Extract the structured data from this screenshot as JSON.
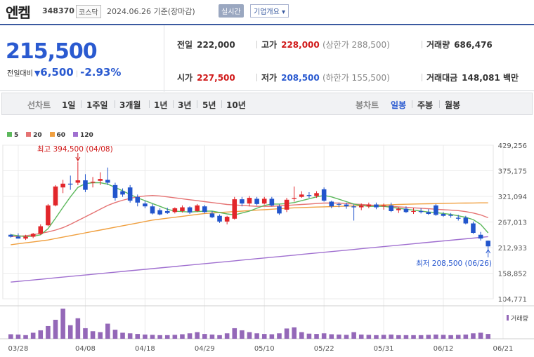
{
  "stock": {
    "name": "엔켐",
    "code": "348370",
    "market": "코스닥",
    "asof": "2024.06.26 기준(장마감)",
    "realtime_label": "실시간",
    "overview_label": "기업개요 ▾",
    "price": "215,500",
    "change_label": "전일대비",
    "change_symbol": "▼",
    "change_value": "6,500",
    "change_pct": "-2.93%"
  },
  "summary": {
    "prev_close": {
      "label": "전일",
      "value": "222,000"
    },
    "high": {
      "label": "고가",
      "value": "228,000",
      "sub": "(상한가 288,500)"
    },
    "volume": {
      "label": "거래량",
      "value": "686,476"
    },
    "open": {
      "label": "시가",
      "value": "227,500"
    },
    "low": {
      "label": "저가",
      "value": "208,500",
      "sub": "(하한가 155,500)"
    },
    "amount": {
      "label": "거래대금",
      "value": "148,081",
      "unit": "백만"
    }
  },
  "tabs": {
    "left_label": "선차트",
    "periods": [
      "1일",
      "1주일",
      "3개월",
      "1년",
      "3년",
      "5년",
      "10년"
    ],
    "right_label": "봉차트",
    "candle_periods": [
      "일봉",
      "주봉",
      "월봉"
    ],
    "active": "일봉"
  },
  "colors": {
    "up": "#e2262b",
    "down": "#2255cc",
    "ma5": "#5cb85c",
    "ma20": "#e57373",
    "ma60": "#f0a040",
    "ma120": "#a070d0",
    "volume": "#9468b8"
  },
  "chart_data": {
    "type": "candlestick",
    "legend": [
      "5",
      "20",
      "60",
      "120"
    ],
    "y_ticks": [
      "429,256",
      "375,175",
      "321,094",
      "267,013",
      "212,933",
      "158,852",
      "104,771"
    ],
    "y_tick_values": [
      429256,
      375175,
      321094,
      267013,
      212933,
      158852,
      104771
    ],
    "ylim": [
      104771,
      429256
    ],
    "x_ticks": [
      "03/28",
      "04/08",
      "04/18",
      "04/29",
      "05/10",
      "05/22",
      "05/31",
      "06/12",
      "06/21"
    ],
    "x_tick_index": [
      1,
      10,
      18,
      26,
      34,
      42,
      50,
      58,
      66
    ],
    "high_annotation": "최고 394,500 (04/08)",
    "low_annotation": "최저 208,500 (06/26)",
    "volume_label": "거래량",
    "candles": [
      [
        240000,
        242000,
        234000,
        236000
      ],
      [
        236000,
        243000,
        232000,
        232000
      ],
      [
        232000,
        240000,
        229000,
        236000
      ],
      [
        236000,
        244000,
        233000,
        242000
      ],
      [
        242000,
        262000,
        240000,
        258000
      ],
      [
        260000,
        305000,
        258000,
        302000
      ],
      [
        302000,
        345000,
        300000,
        342000
      ],
      [
        340000,
        356000,
        328000,
        348000
      ],
      [
        348000,
        365000,
        335000,
        346000
      ],
      [
        350000,
        394500,
        345000,
        355000
      ],
      [
        355000,
        368000,
        330000,
        335000
      ],
      [
        350000,
        362000,
        340000,
        352000
      ],
      [
        354000,
        372000,
        345000,
        358000
      ],
      [
        356000,
        382000,
        345000,
        350000
      ],
      [
        345000,
        350000,
        312000,
        318000
      ],
      [
        332000,
        338000,
        320000,
        325000
      ],
      [
        340000,
        345000,
        308000,
        312000
      ],
      [
        320000,
        325000,
        300000,
        308000
      ],
      [
        306000,
        312000,
        296000,
        300000
      ],
      [
        300000,
        305000,
        283000,
        285000
      ],
      [
        292000,
        296000,
        281000,
        283000
      ],
      [
        290000,
        297000,
        284000,
        286000
      ],
      [
        288000,
        298000,
        285000,
        296000
      ],
      [
        290000,
        302000,
        287000,
        298000
      ],
      [
        298000,
        300000,
        284000,
        287000
      ],
      [
        290000,
        305000,
        288000,
        302000
      ],
      [
        300000,
        303000,
        285000,
        288000
      ],
      [
        285000,
        290000,
        275000,
        277000
      ],
      [
        280000,
        283000,
        265000,
        268000
      ],
      [
        268000,
        280000,
        262000,
        278000
      ],
      [
        274000,
        320000,
        272000,
        315000
      ],
      [
        315000,
        320000,
        300000,
        306000
      ],
      [
        306000,
        322000,
        300000,
        318000
      ],
      [
        316000,
        320000,
        302000,
        305000
      ],
      [
        306000,
        320000,
        304000,
        316000
      ],
      [
        316000,
        320000,
        300000,
        302000
      ],
      [
        300000,
        304000,
        282000,
        285000
      ],
      [
        293000,
        318000,
        288000,
        314000
      ],
      [
        316000,
        342000,
        310000,
        318000
      ],
      [
        320000,
        332000,
        318000,
        325000
      ],
      [
        324000,
        330000,
        318000,
        322000
      ],
      [
        322000,
        332000,
        318000,
        328000
      ],
      [
        336000,
        340000,
        310000,
        312000
      ],
      [
        310000,
        312000,
        296000,
        300000
      ],
      [
        305000,
        308000,
        298000,
        304000
      ],
      [
        304000,
        308000,
        295000,
        300000
      ],
      [
        300000,
        304000,
        270000,
        298000
      ],
      [
        298000,
        306000,
        292000,
        302000
      ],
      [
        300000,
        308000,
        296000,
        304000
      ],
      [
        304000,
        308000,
        294000,
        298000
      ],
      [
        300000,
        306000,
        293000,
        302000
      ],
      [
        302000,
        308000,
        288000,
        290000
      ],
      [
        292000,
        298000,
        286000,
        295000
      ],
      [
        295000,
        300000,
        286000,
        288000
      ],
      [
        289000,
        296000,
        284000,
        290000
      ],
      [
        290000,
        296000,
        285000,
        288000
      ],
      [
        288000,
        294000,
        282000,
        284000
      ],
      [
        302000,
        305000,
        280000,
        282000
      ],
      [
        284000,
        288000,
        278000,
        280000
      ],
      [
        282000,
        286000,
        276000,
        280000
      ],
      [
        276000,
        282000,
        270000,
        274000
      ],
      [
        276000,
        280000,
        262000,
        264000
      ],
      [
        264000,
        268000,
        242000,
        244000
      ],
      [
        240000,
        246000,
        228000,
        232000
      ],
      [
        227500,
        228000,
        208500,
        215500
      ]
    ],
    "ma5": [
      240000,
      238000,
      236000,
      237000,
      240000,
      253000,
      275000,
      298000,
      320000,
      340000,
      348000,
      350000,
      350000,
      347000,
      340000,
      333000,
      325000,
      318000,
      312000,
      306000,
      300000,
      294000,
      290000,
      289000,
      288000,
      289000,
      290000,
      290000,
      287000,
      284000,
      282000,
      286000,
      290000,
      296000,
      302000,
      305000,
      305000,
      306000,
      308000,
      312000,
      316000,
      320000,
      323000,
      320000,
      315000,
      310000,
      305000,
      302000,
      300000,
      300000,
      300000,
      298000,
      296000,
      294000,
      292000,
      290000,
      288000,
      287000,
      285000,
      283000,
      280000,
      277000,
      272000,
      262000,
      244000
    ],
    "ma20": [
      236000,
      237000,
      238000,
      240000,
      243000,
      246000,
      250000,
      255000,
      262000,
      270000,
      278000,
      286000,
      294000,
      302000,
      308000,
      313000,
      317000,
      320000,
      322000,
      323000,
      322000,
      320000,
      318000,
      316000,
      314000,
      312000,
      310000,
      308000,
      306000,
      304000,
      303000,
      302000,
      301000,
      300000,
      300000,
      300000,
      301000,
      302000,
      303000,
      304000,
      305000,
      306000,
      307000,
      307000,
      307000,
      306000,
      305000,
      304000,
      303000,
      302000,
      301000,
      300000,
      299000,
      298000,
      297000,
      296000,
      295000,
      294000,
      293000,
      292000,
      291000,
      289000,
      286000,
      282000,
      276000
    ],
    "ma60": [
      219000,
      221000,
      223000,
      225000,
      227000,
      229000,
      232000,
      235000,
      238000,
      241000,
      244000,
      247000,
      250000,
      253000,
      256000,
      259000,
      262000,
      265000,
      268000,
      271000,
      273000,
      275000,
      277000,
      279000,
      281000,
      283000,
      285000,
      286000,
      287000,
      288000,
      289000,
      290000,
      291000,
      292000,
      293000,
      294000,
      295000,
      296000,
      297000,
      297500,
      298000,
      298500,
      299000,
      299500,
      300000,
      300500,
      301000,
      301500,
      302000,
      302500,
      303000,
      303500,
      304000,
      304500,
      305000,
      305300,
      305600,
      305900,
      306200,
      306500,
      306800,
      307000,
      307200,
      307400,
      307500
    ],
    "ma120": [
      140000,
      141500,
      143000,
      144500,
      146000,
      147500,
      149000,
      150500,
      152000,
      153500,
      155000,
      156500,
      158000,
      159500,
      161000,
      162500,
      164000,
      165500,
      167000,
      168500,
      170000,
      171500,
      173000,
      174500,
      176000,
      177500,
      179000,
      180500,
      182000,
      183500,
      185000,
      186500,
      188000,
      189500,
      191000,
      192500,
      194000,
      195500,
      197000,
      198500,
      200000,
      201500,
      203000,
      204500,
      206000,
      207500,
      209000,
      210500,
      212000,
      213500,
      215000,
      216500,
      218000,
      219500,
      221000,
      222500,
      224000,
      225500,
      227000,
      228500,
      230000,
      231500,
      233000,
      234500,
      236000
    ],
    "volume": [
      0.15,
      0.14,
      0.12,
      0.2,
      0.28,
      0.42,
      0.63,
      1.0,
      0.45,
      0.68,
      0.35,
      0.25,
      0.22,
      0.5,
      0.3,
      0.2,
      0.18,
      0.16,
      0.14,
      0.13,
      0.12,
      0.12,
      0.13,
      0.15,
      0.18,
      0.22,
      0.16,
      0.14,
      0.12,
      0.18,
      0.35,
      0.28,
      0.22,
      0.18,
      0.16,
      0.15,
      0.18,
      0.34,
      0.38,
      0.22,
      0.17,
      0.16,
      0.18,
      0.15,
      0.14,
      0.13,
      0.22,
      0.14,
      0.13,
      0.12,
      0.13,
      0.14,
      0.12,
      0.12,
      0.12,
      0.12,
      0.13,
      0.14,
      0.13,
      0.12,
      0.13,
      0.14,
      0.18,
      0.2,
      0.16
    ],
    "volume_up": [
      false,
      false,
      true,
      true,
      true,
      true,
      true,
      true,
      false,
      true,
      false,
      true,
      true,
      false,
      false,
      false,
      false,
      false,
      false,
      false,
      false,
      false,
      true,
      true,
      false,
      true,
      false,
      false,
      false,
      true,
      true,
      false,
      true,
      false,
      true,
      false,
      false,
      true,
      true,
      true,
      false,
      true,
      false,
      false,
      false,
      false,
      false,
      true,
      true,
      false,
      true,
      false,
      true,
      false,
      true,
      false,
      false,
      false,
      false,
      false,
      false,
      false,
      false,
      false,
      false
    ]
  }
}
